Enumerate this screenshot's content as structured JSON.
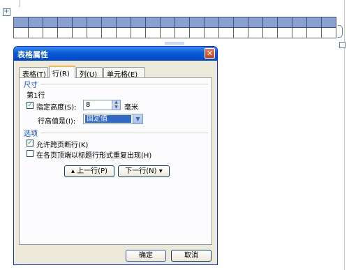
{
  "document": {
    "anchor_glyph": "+",
    "table_columns": 20
  },
  "dialog": {
    "title": "表格属性",
    "close_glyph": "✕",
    "tabs": [
      "表格(T)",
      "行(R)",
      "列(U)",
      "单元格(E)"
    ],
    "active_tab": 1,
    "size_group": "尺寸",
    "row_label": "第1行",
    "specify_height_label": "指定高度(S):",
    "specify_height_checked": true,
    "height_value": "8",
    "unit_label": "毫米",
    "row_height_is_label": "行高值是(I):",
    "row_height_mode": "固定值",
    "options_group": "选项",
    "allow_break_label": "允许跨页断行(K)",
    "allow_break_checked": true,
    "repeat_header_label": "在各页顶端以标题行形式重复出现(H)",
    "repeat_header_checked": false,
    "prev_row_button": "▴ 上一行(P)",
    "next_row_button": "下一行(N) ▾",
    "ok_button": "确定",
    "cancel_button": "取消"
  },
  "colors": {
    "selected_row": "#8aa0cf",
    "titlebar": "#0a5bd6",
    "dialog_face": "#ece9d8",
    "group_title": "#0046d5"
  }
}
